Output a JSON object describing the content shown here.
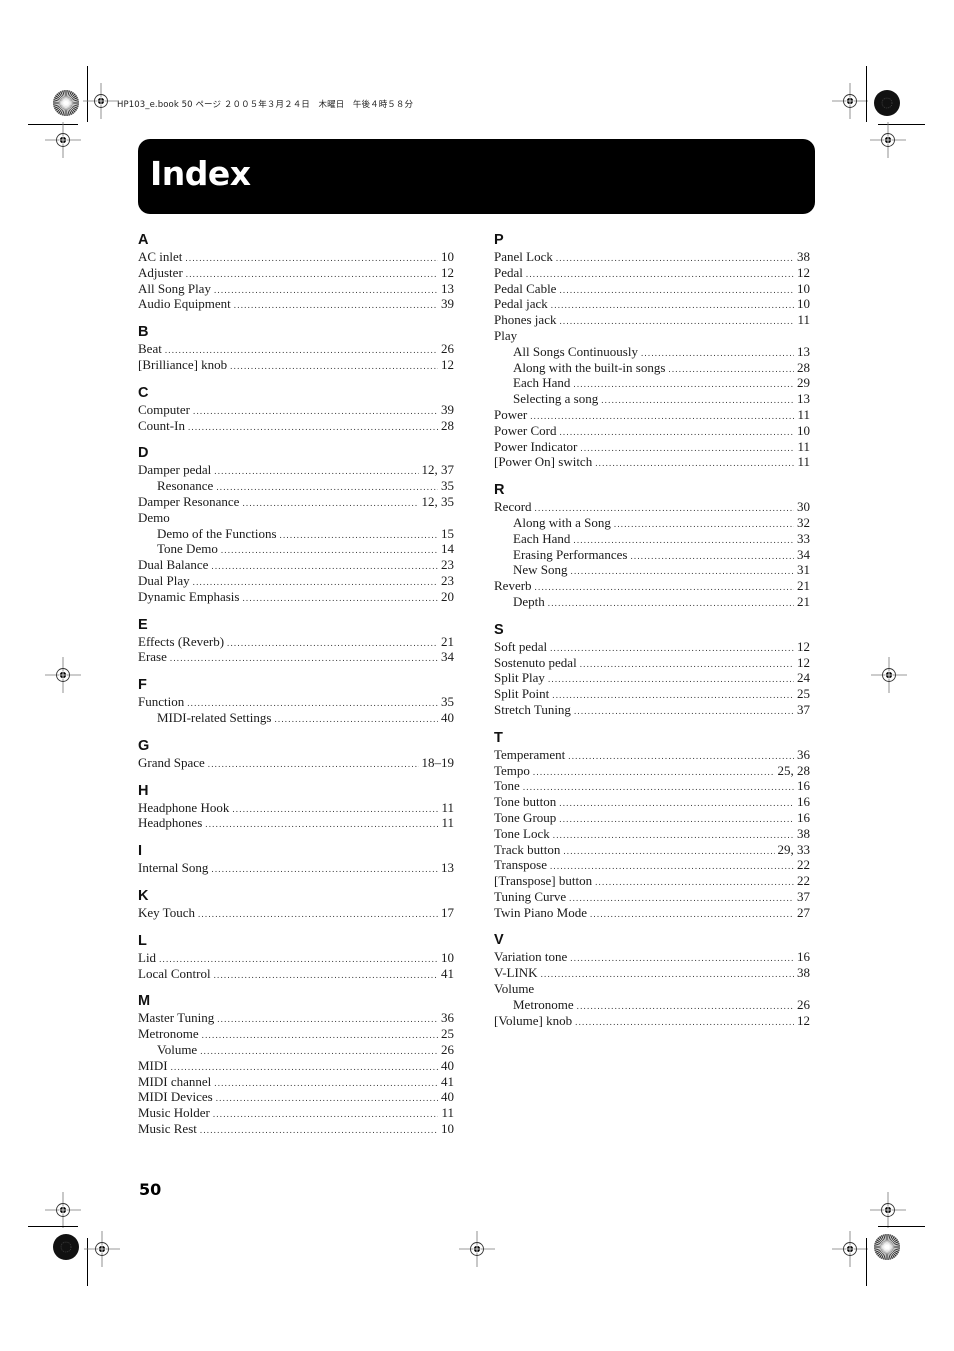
{
  "slug": "HP103_e.book  50 ページ  ２００５年３月２４日　木曜日　午後４時５８分",
  "title": "Index",
  "page_number": "50",
  "left_column": [
    {
      "letter": "A",
      "entries": [
        {
          "term": "AC inlet",
          "pages": "10",
          "level": 0
        },
        {
          "term": "Adjuster",
          "pages": "12",
          "level": 0
        },
        {
          "term": "All Song Play",
          "pages": "13",
          "level": 0
        },
        {
          "term": "Audio Equipment",
          "pages": "39",
          "level": 0
        }
      ]
    },
    {
      "letter": "B",
      "entries": [
        {
          "term": "Beat",
          "pages": "26",
          "level": 0
        },
        {
          "term": "[Brilliance] knob",
          "pages": "12",
          "level": 0
        }
      ]
    },
    {
      "letter": "C",
      "entries": [
        {
          "term": "Computer",
          "pages": "39",
          "level": 0
        },
        {
          "term": "Count-In",
          "pages": "28",
          "level": 0
        }
      ]
    },
    {
      "letter": "D",
      "entries": [
        {
          "term": "Damper pedal",
          "pages": "12, 37",
          "level": 0
        },
        {
          "term": "Resonance",
          "pages": "35",
          "level": 1
        },
        {
          "term": "Damper Resonance",
          "pages": "12, 35",
          "level": 0
        },
        {
          "term": "Demo",
          "pages": "",
          "level": 0
        },
        {
          "term": "Demo of the Functions",
          "pages": "15",
          "level": 1
        },
        {
          "term": "Tone Demo",
          "pages": "14",
          "level": 1
        },
        {
          "term": "Dual Balance",
          "pages": "23",
          "level": 0
        },
        {
          "term": "Dual Play",
          "pages": "23",
          "level": 0
        },
        {
          "term": "Dynamic Emphasis",
          "pages": "20",
          "level": 0
        }
      ]
    },
    {
      "letter": "E",
      "entries": [
        {
          "term": "Effects (Reverb)",
          "pages": "21",
          "level": 0
        },
        {
          "term": "Erase",
          "pages": "34",
          "level": 0
        }
      ]
    },
    {
      "letter": "F",
      "entries": [
        {
          "term": "Function",
          "pages": "35",
          "level": 0
        },
        {
          "term": "MIDI-related Settings",
          "pages": "40",
          "level": 1
        }
      ]
    },
    {
      "letter": "G",
      "entries": [
        {
          "term": "Grand Space",
          "pages": "18–19",
          "level": 0
        }
      ]
    },
    {
      "letter": "H",
      "entries": [
        {
          "term": "Headphone Hook",
          "pages": "11",
          "level": 0
        },
        {
          "term": "Headphones",
          "pages": "11",
          "level": 0
        }
      ]
    },
    {
      "letter": "I",
      "entries": [
        {
          "term": "Internal Song",
          "pages": "13",
          "level": 0
        }
      ]
    },
    {
      "letter": "K",
      "entries": [
        {
          "term": "Key Touch",
          "pages": "17",
          "level": 0
        }
      ]
    },
    {
      "letter": "L",
      "entries": [
        {
          "term": "Lid",
          "pages": "10",
          "level": 0
        },
        {
          "term": "Local Control",
          "pages": "41",
          "level": 0
        }
      ]
    },
    {
      "letter": "M",
      "entries": [
        {
          "term": "Master Tuning",
          "pages": "36",
          "level": 0
        },
        {
          "term": "Metronome",
          "pages": "25",
          "level": 0
        },
        {
          "term": "Volume",
          "pages": "26",
          "level": 1
        },
        {
          "term": "MIDI",
          "pages": "40",
          "level": 0
        },
        {
          "term": "MIDI channel",
          "pages": "41",
          "level": 0
        },
        {
          "term": "MIDI Devices",
          "pages": "40",
          "level": 0
        },
        {
          "term": "Music Holder",
          "pages": "11",
          "level": 0
        },
        {
          "term": "Music Rest",
          "pages": "10",
          "level": 0
        }
      ]
    }
  ],
  "right_column": [
    {
      "letter": "P",
      "entries": [
        {
          "term": "Panel Lock",
          "pages": "38",
          "level": 0
        },
        {
          "term": "Pedal",
          "pages": "12",
          "level": 0
        },
        {
          "term": "Pedal Cable",
          "pages": "10",
          "level": 0
        },
        {
          "term": "Pedal jack",
          "pages": "10",
          "level": 0
        },
        {
          "term": "Phones jack",
          "pages": "11",
          "level": 0
        },
        {
          "term": "Play",
          "pages": "",
          "level": 0
        },
        {
          "term": "All Songs Continuously",
          "pages": "13",
          "level": 1
        },
        {
          "term": "Along with the built-in songs",
          "pages": "28",
          "level": 1
        },
        {
          "term": "Each Hand",
          "pages": "29",
          "level": 1
        },
        {
          "term": "Selecting a song",
          "pages": "13",
          "level": 1
        },
        {
          "term": "Power",
          "pages": "11",
          "level": 0
        },
        {
          "term": "Power Cord",
          "pages": "10",
          "level": 0
        },
        {
          "term": "Power Indicator",
          "pages": "11",
          "level": 0
        },
        {
          "term": "[Power On] switch",
          "pages": "11",
          "level": 0
        }
      ]
    },
    {
      "letter": "R",
      "entries": [
        {
          "term": "Record",
          "pages": "30",
          "level": 0
        },
        {
          "term": "Along with a Song",
          "pages": "32",
          "level": 1
        },
        {
          "term": "Each Hand",
          "pages": "33",
          "level": 1
        },
        {
          "term": "Erasing Performances",
          "pages": "34",
          "level": 1
        },
        {
          "term": "New Song",
          "pages": "31",
          "level": 1
        },
        {
          "term": "Reverb",
          "pages": "21",
          "level": 0
        },
        {
          "term": "Depth",
          "pages": "21",
          "level": 1
        }
      ]
    },
    {
      "letter": "S",
      "entries": [
        {
          "term": "Soft pedal",
          "pages": "12",
          "level": 0
        },
        {
          "term": "Sostenuto pedal",
          "pages": "12",
          "level": 0
        },
        {
          "term": "Split Play",
          "pages": "24",
          "level": 0
        },
        {
          "term": "Split Point",
          "pages": "25",
          "level": 0
        },
        {
          "term": "Stretch Tuning",
          "pages": "37",
          "level": 0
        }
      ]
    },
    {
      "letter": "T",
      "entries": [
        {
          "term": "Temperament",
          "pages": "36",
          "level": 0
        },
        {
          "term": "Tempo",
          "pages": "25, 28",
          "level": 0
        },
        {
          "term": "Tone",
          "pages": "16",
          "level": 0
        },
        {
          "term": "Tone button",
          "pages": "16",
          "level": 0
        },
        {
          "term": "Tone Group",
          "pages": "16",
          "level": 0
        },
        {
          "term": "Tone Lock",
          "pages": "38",
          "level": 0
        },
        {
          "term": "Track button",
          "pages": "29, 33",
          "level": 0
        },
        {
          "term": "Transpose",
          "pages": "22",
          "level": 0
        },
        {
          "term": "[Transpose] button",
          "pages": "22",
          "level": 0
        },
        {
          "term": "Tuning Curve",
          "pages": "37",
          "level": 0
        },
        {
          "term": "Twin Piano Mode",
          "pages": "27",
          "level": 0
        }
      ]
    },
    {
      "letter": "V",
      "entries": [
        {
          "term": "Variation tone",
          "pages": "16",
          "level": 0
        },
        {
          "term": "V-LINK",
          "pages": "38",
          "level": 0
        },
        {
          "term": "Volume",
          "pages": "",
          "level": 0
        },
        {
          "term": "Metronome",
          "pages": "26",
          "level": 1
        },
        {
          "term": "[Volume] knob",
          "pages": "12",
          "level": 0
        }
      ]
    }
  ]
}
